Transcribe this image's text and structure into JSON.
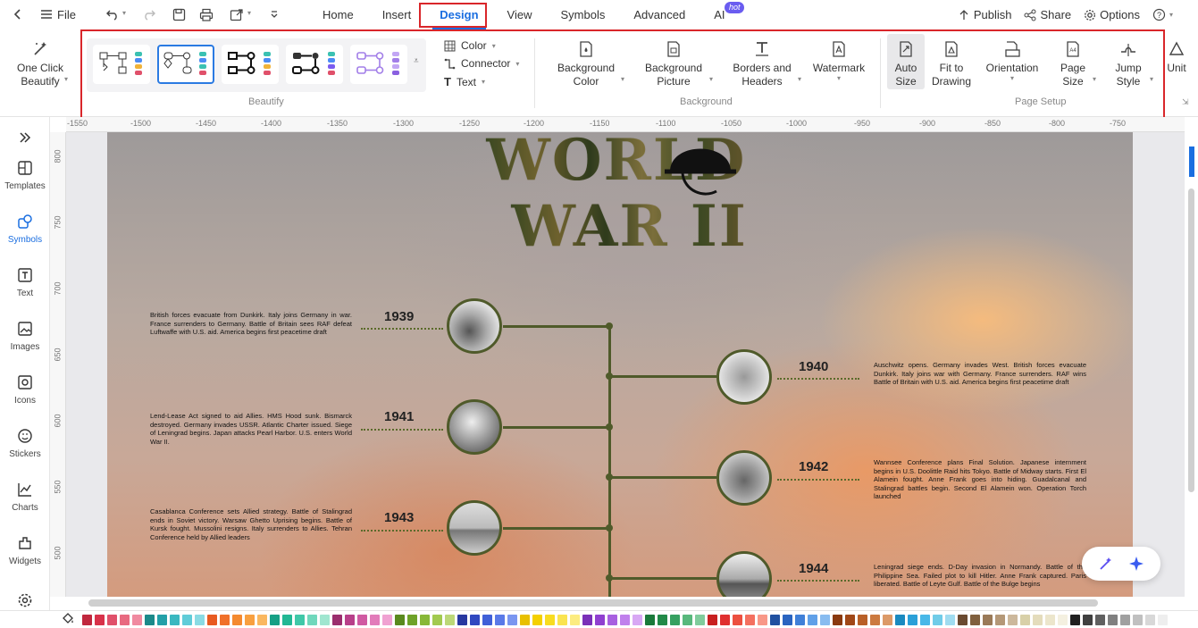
{
  "topbar": {
    "file_label": "File",
    "menu": [
      {
        "label": "Home",
        "active": false
      },
      {
        "label": "Insert",
        "active": false
      },
      {
        "label": "Design",
        "active": true
      },
      {
        "label": "View",
        "active": false
      },
      {
        "label": "Symbols",
        "active": false
      },
      {
        "label": "Advanced",
        "active": false
      },
      {
        "label": "AI",
        "active": false
      }
    ],
    "ai_badge": "hot",
    "publish": "Publish",
    "share": "Share",
    "options": "Options"
  },
  "ribbon": {
    "one_click": "One Click Beautify",
    "color": "Color",
    "connector": "Connector",
    "text": "Text",
    "beautify_label": "Beautify",
    "background_color": "Background Color",
    "background_picture": "Background Picture",
    "borders_headers": "Borders and Headers",
    "watermark": "Watermark",
    "background_label": "Background",
    "auto_size": "Auto Size",
    "fit_to_drawing": "Fit to Drawing",
    "orientation": "Orientation",
    "page_size": "Page Size",
    "jump_style": "Jump Style",
    "unit": "Unit",
    "page_setup_label": "Page Setup",
    "accent": "#2a7ae2",
    "highlight": "#d9262a"
  },
  "sidebar": {
    "items": [
      {
        "label": "",
        "icon": "expand-icon"
      },
      {
        "label": "Templates",
        "icon": "templates-icon"
      },
      {
        "label": "Symbols",
        "icon": "symbols-icon",
        "active": true
      },
      {
        "label": "Text",
        "icon": "text-icon"
      },
      {
        "label": "Images",
        "icon": "images-icon"
      },
      {
        "label": "Icons",
        "icon": "icons-icon"
      },
      {
        "label": "Stickers",
        "icon": "stickers-icon"
      },
      {
        "label": "Charts",
        "icon": "charts-icon"
      },
      {
        "label": "Widgets",
        "icon": "widgets-icon"
      },
      {
        "label": "",
        "icon": "settings-icon"
      }
    ]
  },
  "ruler": {
    "top": [
      "-1550",
      "-1500",
      "-1450",
      "-1400",
      "-1350",
      "-1300",
      "-1250",
      "-1200",
      "-1150",
      "-1100",
      "-1050",
      "-1000",
      "-950",
      "-900",
      "-850",
      "-800",
      "-750"
    ],
    "left": [
      "800",
      "750",
      "700",
      "650",
      "600",
      "550",
      "500"
    ]
  },
  "poster": {
    "title_line1": "WORLD",
    "title_line2": "WAR II",
    "events": [
      {
        "year": "1939",
        "side": "left",
        "text": "British forces evacuate from Dunkirk. Italy joins Germany in war. France surrenders to Germany. Battle of Britain sees RAF defeat Luftwaffe with U.S. aid. America begins first peacetime draft"
      },
      {
        "year": "1940",
        "side": "right",
        "text": "Auschwitz opens. Germany invades West. British forces evacuate Dunkirk. Italy joins war with Germany. France surrenders. RAF wins Battle of Britain with U.S. aid. America begins first peacetime draft"
      },
      {
        "year": "1941",
        "side": "left",
        "text": "Lend-Lease Act signed to aid Allies. HMS Hood sunk. Bismarck destroyed. Germany invades USSR. Atlantic Charter issued. Siege of Leningrad begins. Japan attacks Pearl Harbor. U.S. enters World War II."
      },
      {
        "year": "1942",
        "side": "right",
        "text": "Wannsee Conference plans Final Solution. Japanese internment begins in U.S. Doolittle Raid hits Tokyo. Battle of Midway starts. First El Alamein fought. Anne Frank goes into hiding. Guadalcanal and Stalingrad battles begin. Second El Alamein won. Operation Torch launched"
      },
      {
        "year": "1943",
        "side": "left",
        "text": "Casablanca Conference sets Allied strategy. Battle of Stalingrad ends in Soviet victory. Warsaw Ghetto Uprising begins. Battle of Kursk fought. Mussolini resigns. Italy surrenders to Allies. Tehran Conference held by Allied leaders"
      },
      {
        "year": "1944",
        "side": "right",
        "text": "Leningrad siege ends. D-Day invasion in Normandy. Battle of the Philippine Sea. Failed plot to kill Hitler. Anne Frank captured. Paris liberated. Battle of Leyte Gulf. Battle of the Bulge begins"
      }
    ]
  },
  "palette": [
    "#c0273d",
    "#d8324a",
    "#e0506a",
    "#e86a80",
    "#f08aa0",
    "#1b8a8a",
    "#22a0a8",
    "#3ab8c0",
    "#60ccd8",
    "#8adbe4",
    "#e85a20",
    "#f0702a",
    "#f48a30",
    "#f8a040",
    "#fab860",
    "#16a085",
    "#22b894",
    "#40c8a8",
    "#70d8bc",
    "#a0e6d0",
    "#9b2e6e",
    "#b8408a",
    "#d05aa2",
    "#e27cba",
    "#f0a2d2",
    "#5a8a1e",
    "#6ea228",
    "#88b838",
    "#a2ca50",
    "#bcd878",
    "#2838a0",
    "#3048c0",
    "#4060d8",
    "#5a7ae8",
    "#7a96f0",
    "#e8c000",
    "#f4d000",
    "#f8dc20",
    "#fae450",
    "#fcec80",
    "#7a30b8",
    "#9040d0",
    "#a860e0",
    "#c080ec",
    "#d8a8f4",
    "#1a7a3a",
    "#228a48",
    "#36a060",
    "#58b87c",
    "#80cc9c",
    "#c82020",
    "#e03030",
    "#ec5040",
    "#f47060",
    "#f89888",
    "#2050a0",
    "#2a64c0",
    "#4080d8",
    "#60a0e8",
    "#88bcf0",
    "#8a3a10",
    "#a04818",
    "#b86028",
    "#cc7a40",
    "#dc9a68",
    "#1a8ac0",
    "#2aa0d8",
    "#48b8e8",
    "#70cce8",
    "#a0dcf0",
    "#6a4a30",
    "#80603e",
    "#9a7a58",
    "#b49878",
    "#ccb89c",
    "#d8d0a8",
    "#e4dcbc",
    "#ece6cc",
    "#f4f0e0",
    "#202020",
    "#404040",
    "#606060",
    "#808080",
    "#a0a0a0",
    "#c0c0c0",
    "#d8d8d8",
    "#eeeeee"
  ]
}
